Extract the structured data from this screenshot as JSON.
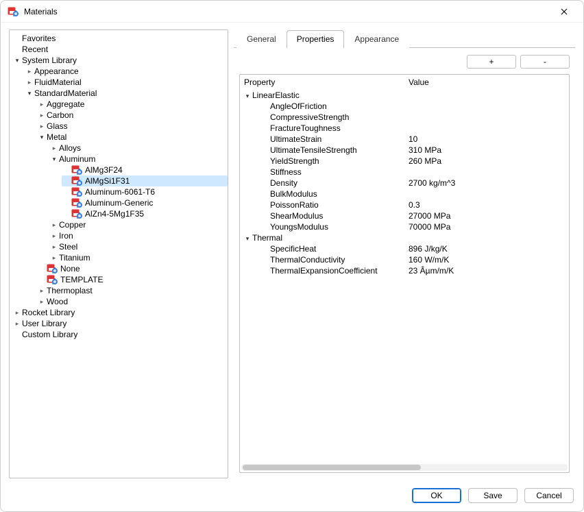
{
  "window": {
    "title": "Materials",
    "close_icon": "close-icon"
  },
  "tree": {
    "favorites": "Favorites",
    "recent": "Recent",
    "system_library": "System Library",
    "appearance": "Appearance",
    "fluid_material": "FluidMaterial",
    "standard_material": "StandardMaterial",
    "aggregate": "Aggregate",
    "carbon": "Carbon",
    "glass": "Glass",
    "metal": "Metal",
    "alloys": "Alloys",
    "aluminum": "Aluminum",
    "al_items": {
      "0": "AlMg3F24",
      "1": "AlMgSi1F31",
      "2": "Aluminum-6061-T6",
      "3": "Aluminum-Generic",
      "4": "AlZn4-5Mg1F35"
    },
    "copper": "Copper",
    "iron": "Iron",
    "steel": "Steel",
    "titanium": "Titanium",
    "none": "None",
    "template": "TEMPLATE",
    "thermoplast": "Thermoplast",
    "wood": "Wood",
    "rocket_library": "Rocket Library",
    "user_library": "User Library",
    "custom_library": "Custom Library"
  },
  "tabs": {
    "general": "General",
    "properties": "Properties",
    "appearance": "Appearance"
  },
  "btnbar": {
    "add": "+",
    "remove": "-"
  },
  "props": {
    "header_property": "Property",
    "header_value": "Value",
    "groups": {
      "linear_elastic": "LinearElastic",
      "thermal": "Thermal"
    },
    "rows": {
      "angle_of_friction": {
        "name": "AngleOfFriction",
        "value": ""
      },
      "compressive_strength": {
        "name": "CompressiveStrength",
        "value": ""
      },
      "fracture_toughness": {
        "name": "FractureToughness",
        "value": ""
      },
      "ultimate_strain": {
        "name": "UltimateStrain",
        "value": "10"
      },
      "ultimate_tensile_strength": {
        "name": "UltimateTensileStrength",
        "value": "310 MPa"
      },
      "yield_strength": {
        "name": "YieldStrength",
        "value": "260 MPa"
      },
      "stiffness": {
        "name": "Stiffness",
        "value": ""
      },
      "density": {
        "name": "Density",
        "value": "2700 kg/m^3"
      },
      "bulk_modulus": {
        "name": "BulkModulus",
        "value": ""
      },
      "poisson_ratio": {
        "name": "PoissonRatio",
        "value": "0.3"
      },
      "shear_modulus": {
        "name": "ShearModulus",
        "value": "27000 MPa"
      },
      "youngs_modulus": {
        "name": "YoungsModulus",
        "value": "70000 MPa"
      },
      "specific_heat": {
        "name": "SpecificHeat",
        "value": "896 J/kg/K"
      },
      "thermal_conductivity": {
        "name": "ThermalConductivity",
        "value": "160 W/m/K"
      },
      "thermal_expansion": {
        "name": "ThermalExpansionCoefficient",
        "value": "23 Âµm/m/K"
      }
    }
  },
  "footer": {
    "ok": "OK",
    "save": "Save",
    "cancel": "Cancel"
  }
}
